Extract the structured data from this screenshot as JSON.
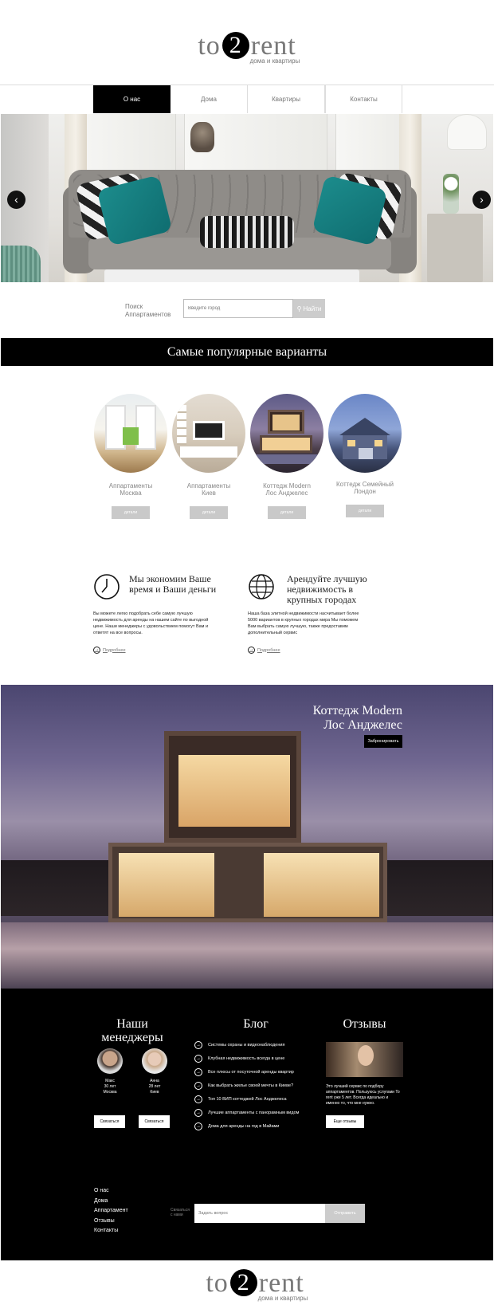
{
  "brand": {
    "logo_left": "to",
    "logo_num": "2",
    "logo_right": "rent",
    "tagline": "дома и квартиры"
  },
  "nav": [
    {
      "label": "О нас",
      "active": true
    },
    {
      "label": "Дома"
    },
    {
      "label": "Квартиры"
    },
    {
      "label": "Контакты"
    }
  ],
  "hero": {
    "prev": "‹",
    "next": "›"
  },
  "search": {
    "label_line1": "Поиск",
    "label_line2": "Аппартаментов",
    "placeholder": "Введите город",
    "button": "Найти"
  },
  "popular": {
    "title": "Самые популярные варианты",
    "cards": [
      {
        "line1": "Аппартаменты",
        "line2": "Москва",
        "button": "детали"
      },
      {
        "line1": "Аппартаменты",
        "line2": "Киев",
        "button": "детали"
      },
      {
        "line1": "Коттедж Modern",
        "line2": "Лос Анджелес",
        "button": "детали"
      },
      {
        "line1": "Коттедж Семейный",
        "line2": "Лондон",
        "button": "детали"
      }
    ]
  },
  "features": [
    {
      "title": "Мы экономим Ваше время и Ваши деньги",
      "text": "Вы можете легко подобрать себе самую лучшую недвижимость для аренды на нашем сайте по выгодной цене. Наши менеджеры с удовольствием помогут Вам и ответят на все вопросы.",
      "more": "Подробнее",
      "icon": "clock-icon"
    },
    {
      "title": "Арендуйте лучшую недвижимость в крупных городах",
      "text": "Наша база элитной недвижимости насчитывает более 5000 вариантов в крупных городах мира Мы поможем Вам выбрать самую лучшую, также предоставим дополнительный сервис",
      "more": "Подробнее",
      "icon": "globe-icon"
    }
  ],
  "showcase": {
    "line1": "Коттедж Modern",
    "line2": "Лос Анджелес",
    "button": "Забронировать"
  },
  "managers": {
    "title_line1": "Наши",
    "title_line2": "менеджеры",
    "people": [
      {
        "name": "Макс",
        "age": "30 лет",
        "city": "Москва",
        "button": "Связаться"
      },
      {
        "name": "Анна",
        "age": "28 лет",
        "city": "Киев",
        "button": "Связаться"
      }
    ]
  },
  "blog": {
    "title": "Блог",
    "items": [
      "Системы охраны и видеонаблюдения",
      "Клубная недвижимость всегда в цене",
      "Все плюсы от посуточной аренды квартир",
      "Как выбрать жилье своей мечты в Киеве?",
      "Топ 10 ВИП коттеджей Лос Анджелеса",
      "Лучшие аппартаменты с панорамным видом",
      "Дома для аренды на год в Майами"
    ]
  },
  "reviews": {
    "title": "Отзывы",
    "text": "Это лучший сервис по подбору аппартаментов. Пользуюсь услугами To rent уже 5 лет. Всегда идеально и именно то, что мне нужно.",
    "button": "Еще отзывы"
  },
  "footer_nav": [
    "О нас",
    "Дома",
    "Аппартамент",
    "Отзывы",
    "Контакты"
  ],
  "contact": {
    "label_line1": "Связаться",
    "label_line2": "с нами",
    "placeholder": "Задать вопрос",
    "button": "Отправить"
  },
  "colors": {
    "accent": "#000000",
    "muted": "#777777",
    "button_gray": "#c9c9c9"
  }
}
